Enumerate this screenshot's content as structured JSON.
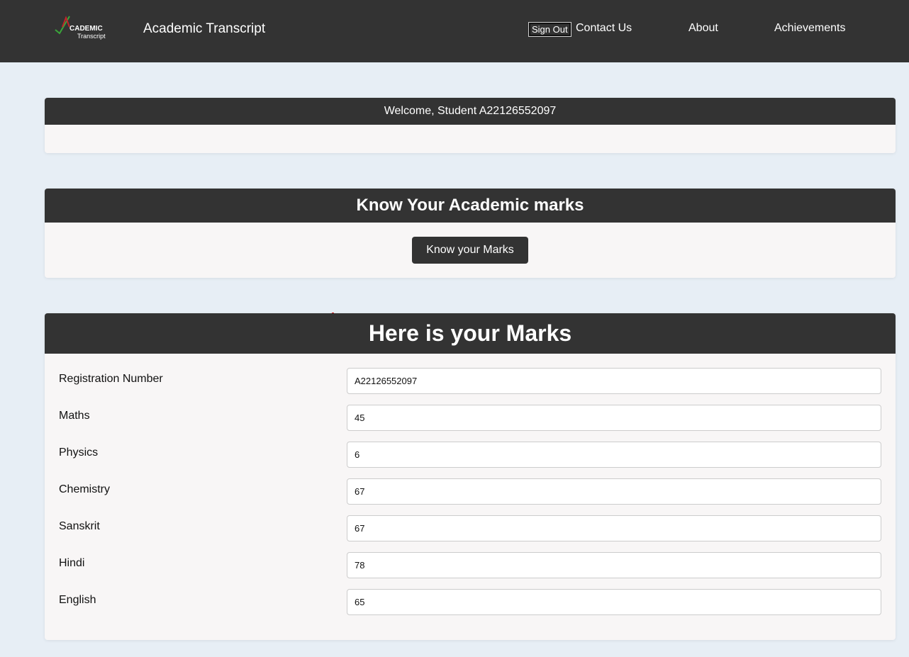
{
  "nav": {
    "logo_text_main": "CADEMIC",
    "logo_text_sub": "Transcript",
    "title": "Academic Transcript",
    "sign_out": "Sign Out",
    "links": [
      "Contact Us",
      "About",
      "Achievements"
    ]
  },
  "welcome": {
    "text": "Welcome, Student A22126552097"
  },
  "know": {
    "heading": "Know Your Academic marks",
    "button": "Know your Marks"
  },
  "marks": {
    "heading": "Here is your Marks",
    "fields": [
      {
        "label": "Registration Number",
        "value": "A22126552097"
      },
      {
        "label": "Maths",
        "value": "45"
      },
      {
        "label": "Physics",
        "value": "6"
      },
      {
        "label": "Chemistry",
        "value": "67"
      },
      {
        "label": "Sanskrit",
        "value": "67"
      },
      {
        "label": "Hindi",
        "value": "78"
      },
      {
        "label": "English",
        "value": "65"
      }
    ]
  },
  "colors": {
    "navbar": "#333333",
    "page_bg": "#e7eef5",
    "card_bg": "#f8f6f6",
    "logo_accent_red": "#c0262b",
    "logo_accent_green": "#3aa63a"
  }
}
